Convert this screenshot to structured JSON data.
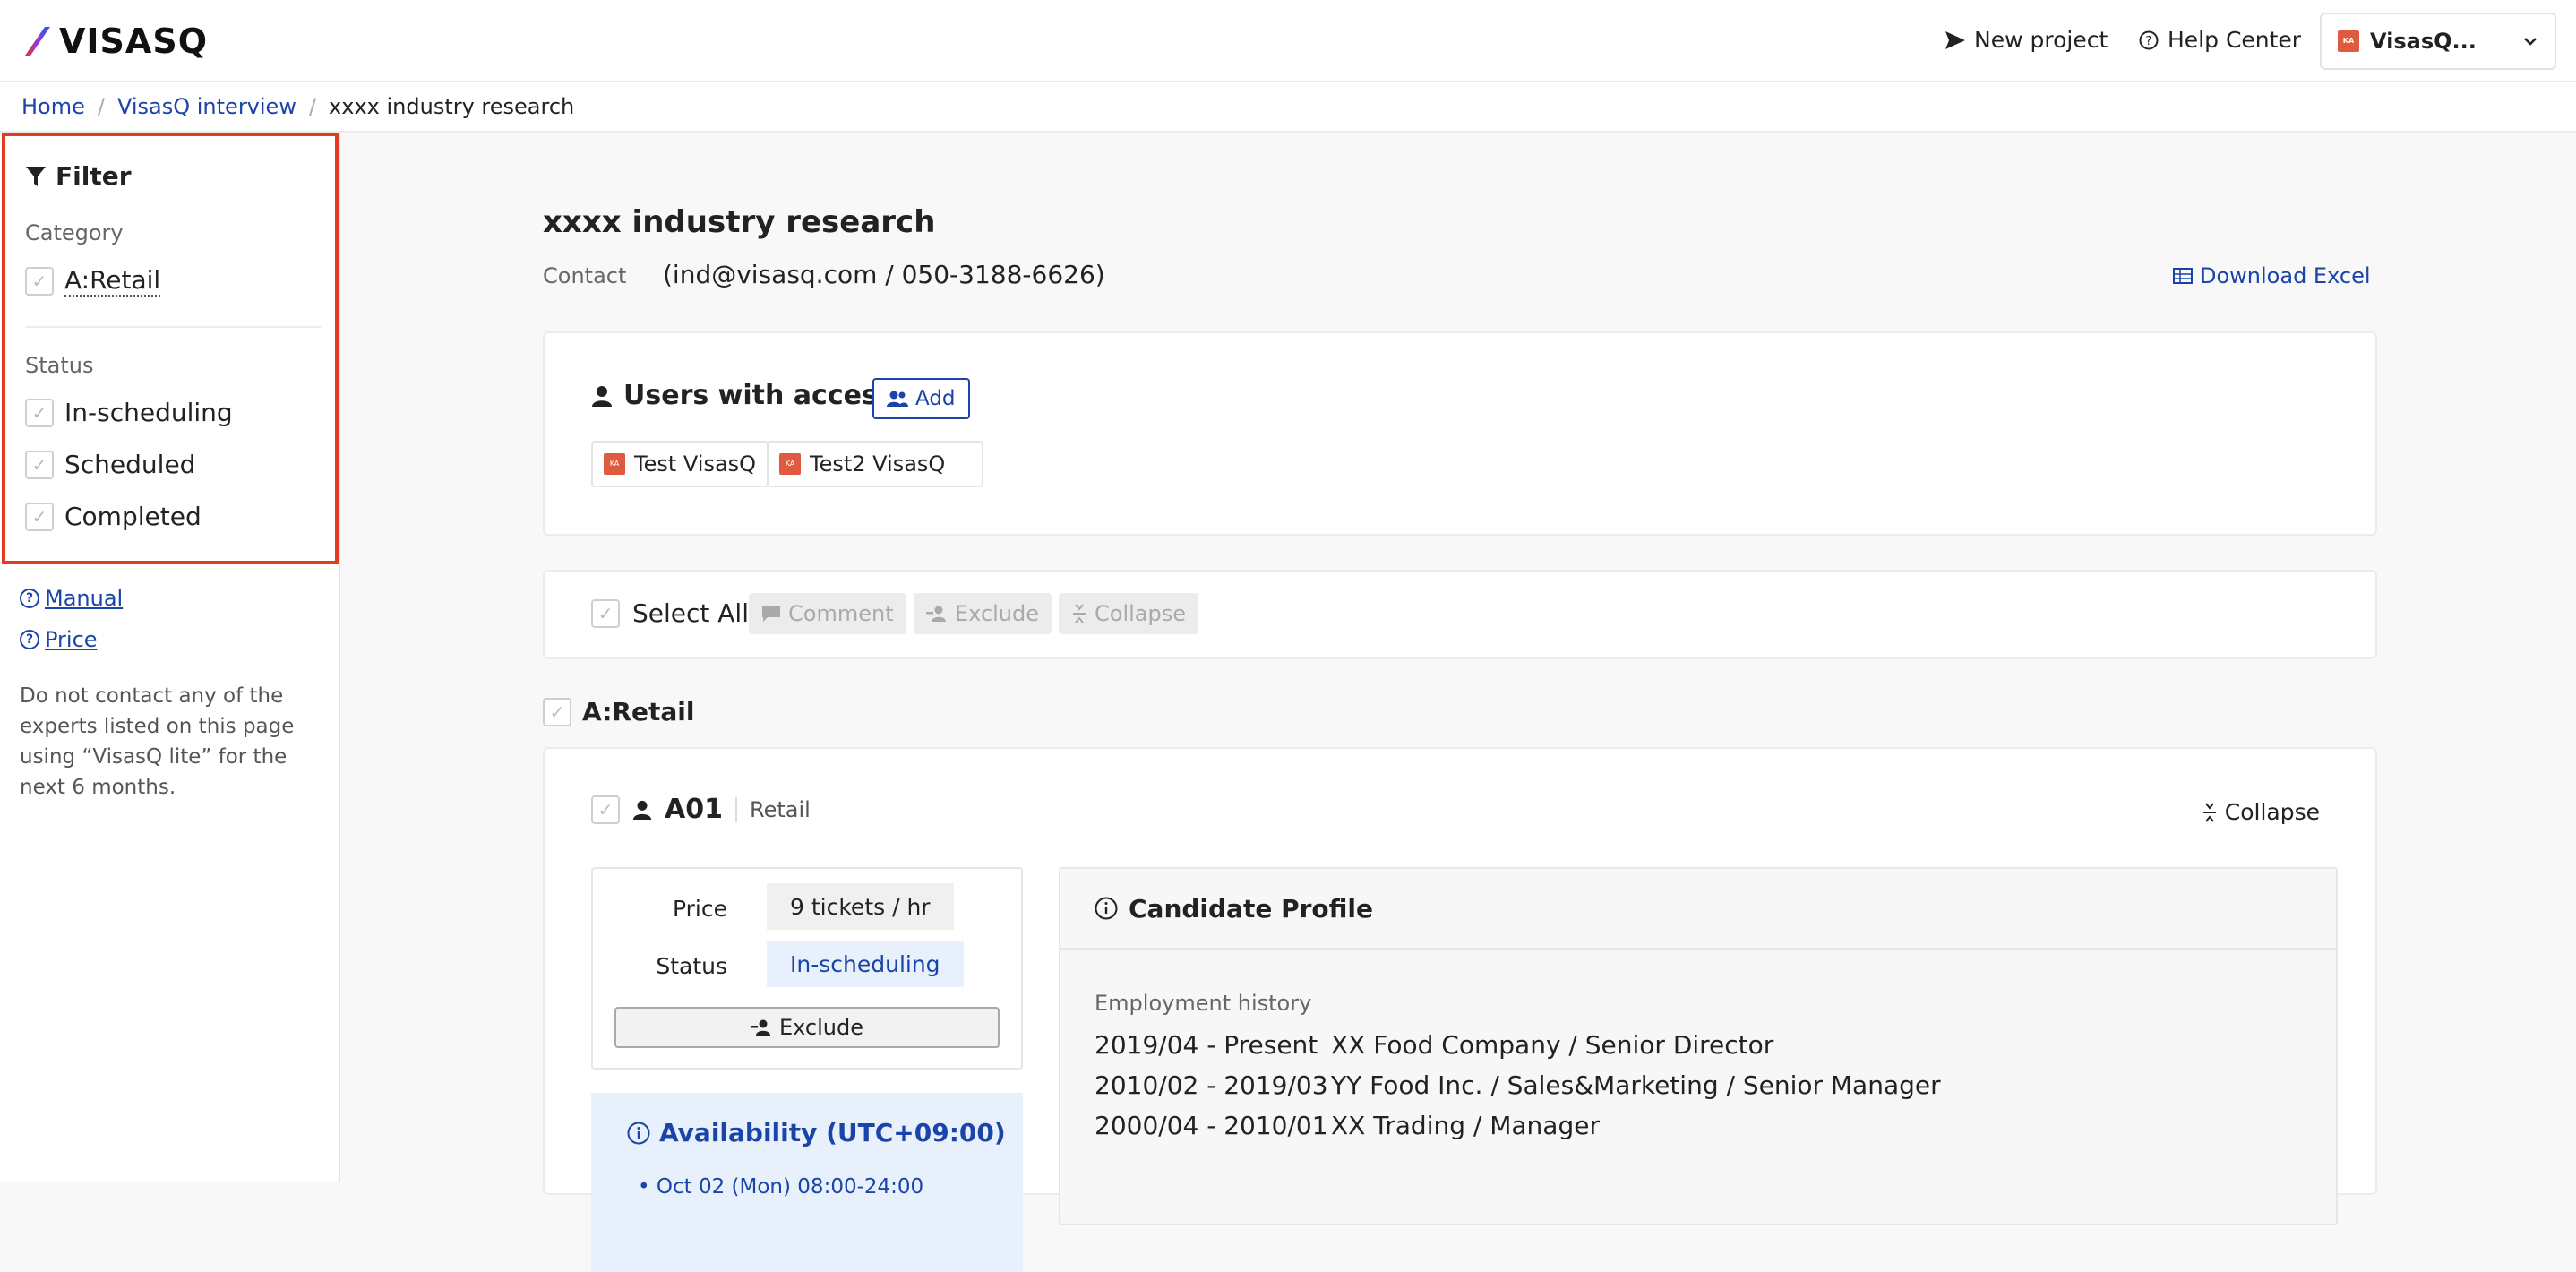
{
  "header": {
    "logo_text": "VISASQ",
    "new_project": "New project",
    "help_center": "Help Center",
    "account_label": "VisasQ...",
    "account_initials": "KA"
  },
  "breadcrumb": {
    "home": "Home",
    "parent": "VisasQ interview",
    "current": "xxxx industry research",
    "separator": "/"
  },
  "sidebar": {
    "filter_title": "Filter",
    "category_label": "Category",
    "categories": [
      "A:Retail"
    ],
    "status_label": "Status",
    "statuses": [
      "In-scheduling",
      "Scheduled",
      "Completed"
    ],
    "manual_link": "Manual",
    "price_link": "Price",
    "note": "Do not contact any of the experts listed on this page using “VisasQ lite” for the next 6 months."
  },
  "project": {
    "title": "xxxx industry research",
    "contact_label": "Contact",
    "contact_value": "(ind@visasq.com / 050-3188-6626)",
    "download_label": "Download Excel"
  },
  "access": {
    "title": "Users with access",
    "add_label": "Add",
    "users": [
      {
        "name": "Test VisasQ",
        "initials": "KA"
      },
      {
        "name": "Test2 VisasQ",
        "initials": "KA"
      }
    ]
  },
  "toolbar": {
    "select_all": "Select All",
    "comment": "Comment",
    "exclude": "Exclude",
    "collapse": "Collapse"
  },
  "group": {
    "label": "A:Retail"
  },
  "candidate": {
    "id": "A01",
    "category": "Retail",
    "collapse_label": "Collapse",
    "price_label": "Price",
    "price_value": "9 tickets / hr",
    "status_label": "Status",
    "status_value": "In-scheduling",
    "exclude_label": "Exclude",
    "availability_title": "Availability (UTC+09:00)",
    "availability_first": "Oct 02 (Mon) 08:00-24:00",
    "profile_title": "Candidate Profile",
    "employment_label": "Employment history",
    "employment": [
      {
        "dates": "2019/04 - Present",
        "detail": "XX Food Company  / Senior Director"
      },
      {
        "dates": "2010/02 - 2019/03",
        "detail": "YY Food Inc. / Sales&Marketing / Senior Manager"
      },
      {
        "dates": "2000/04 - 2010/01",
        "detail": "XX Trading / Manager"
      }
    ]
  },
  "colors": {
    "accent_blue": "#1a44a8",
    "filter_highlight": "#e03c22",
    "avatar": "#e05a3f",
    "status_bg": "#e8f1fb"
  }
}
